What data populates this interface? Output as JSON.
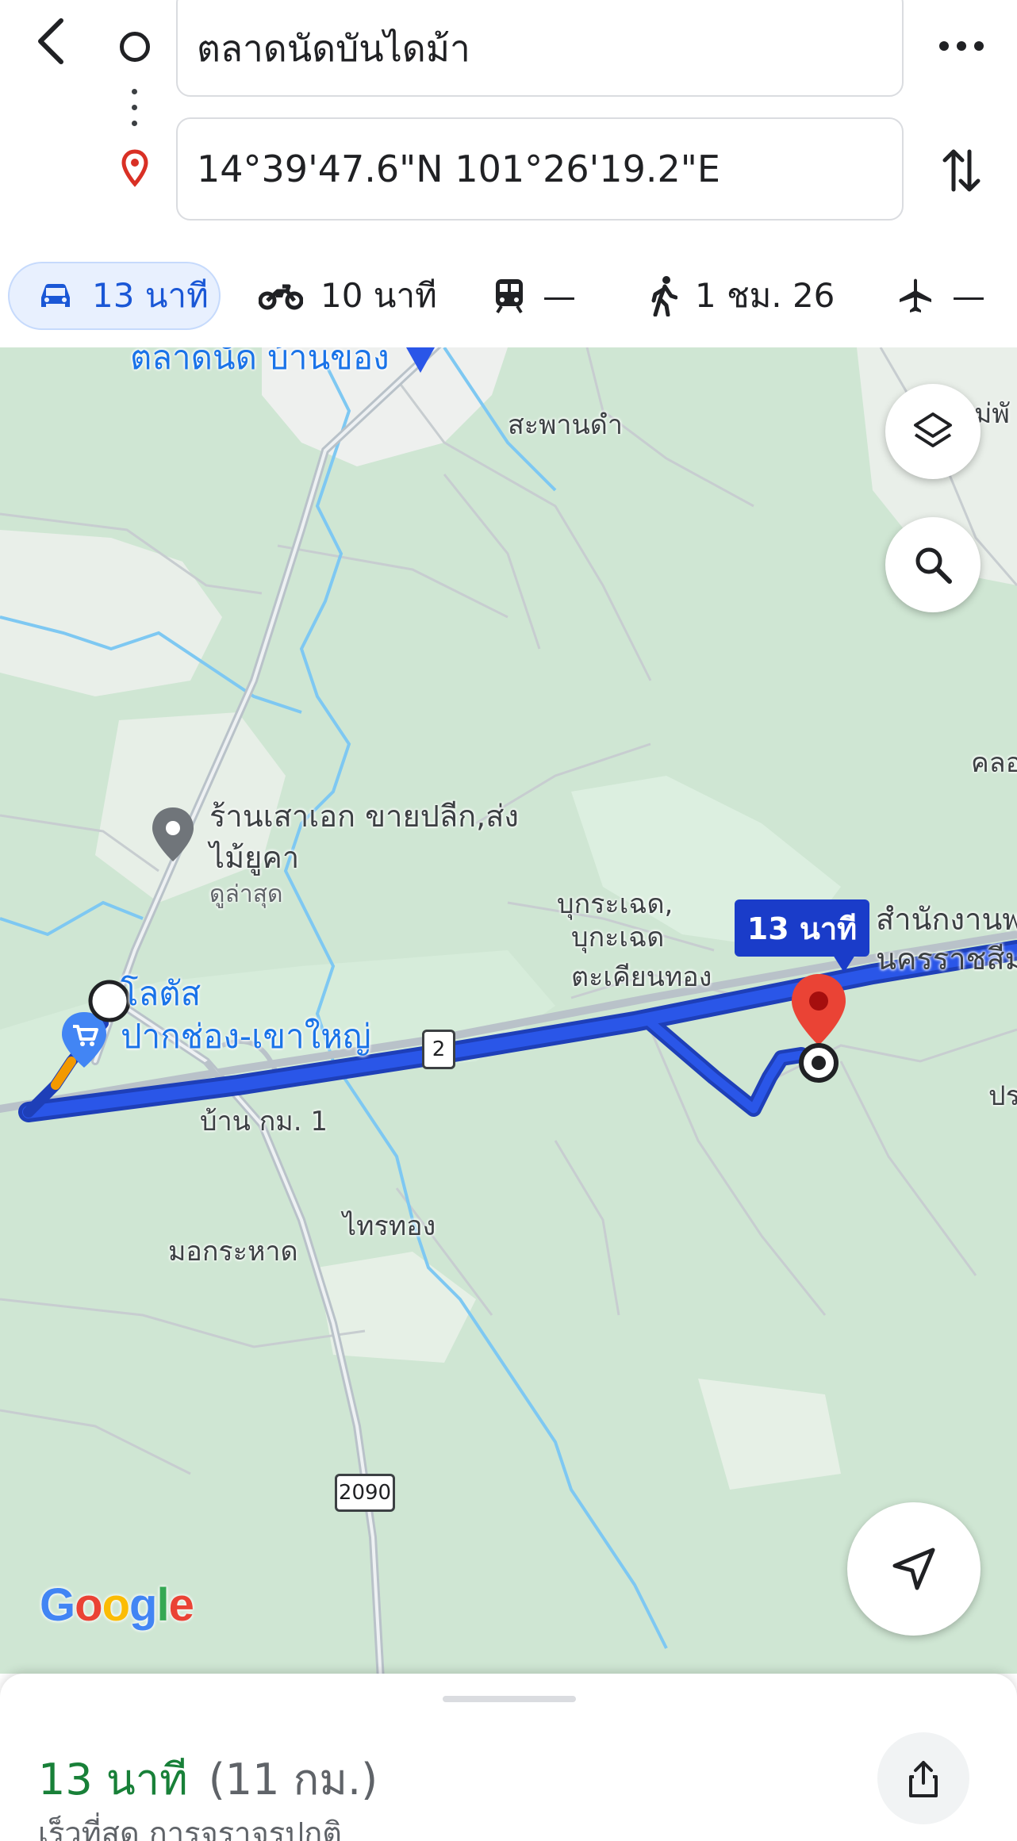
{
  "header": {
    "origin_value": "ตลาดนัดบันไดม้า",
    "destination_value": "14°39'47.6\"N 101°26'19.2\"E",
    "icons": {
      "back": "chevron-left-icon",
      "more": "more-horizontal-icon",
      "swap": "swap-vertical-icon"
    }
  },
  "modes": [
    {
      "id": "car",
      "icon": "car-icon",
      "label": "13 นาที",
      "selected": true
    },
    {
      "id": "motorcycle",
      "icon": "motorcycle-icon",
      "label": "10 นาที",
      "selected": false
    },
    {
      "id": "transit",
      "icon": "train-icon",
      "label": "—",
      "selected": false
    },
    {
      "id": "walk",
      "icon": "walk-icon",
      "label": "1 ชม. 26",
      "selected": false
    },
    {
      "id": "flight",
      "icon": "airplane-icon",
      "label": "—",
      "selected": false
    }
  ],
  "map": {
    "labels": {
      "top_partial": "ตลาดนัด บ้านของ",
      "saphan_dam": "สะพานดำ",
      "mae_phai": "ม่พั",
      "khlong": "คลอ",
      "shop_line1": "ร้านเสาเอก ขายปลีก,ส่ง",
      "shop_line2": "ไม้ยูคา",
      "shop_sub": "ดูล่าสุด",
      "bukraset": "บุกระเฉด,",
      "bukraset2": "บุกะเฉด",
      "takhian_thong": "ตะเคียนทอง",
      "office_line1": "สำนักงานพ",
      "office_line2": "นครราชสีม",
      "lotus_line1": "โลตัส",
      "lotus_line2": "ปากช่อง-เขาใหญ่",
      "ban_km1": "บ้าน กม. 1",
      "pra": "ปร",
      "sai_thong": "ไทรทอง",
      "mok_rahat": "มอกระหาด"
    },
    "route_callout": "13 นาที",
    "shields": {
      "hwy2": "2",
      "hwy2090": "2090"
    },
    "google_logo": "Google",
    "colors": {
      "route": "#2a56e8",
      "callout": "#1a3cc9",
      "pin": "#ea4335",
      "land": "#cfe6d3",
      "water": "#7ec8f2"
    }
  },
  "sheet": {
    "duration": "13 นาที",
    "distance": "(11 กม.)",
    "subtitle": "เร็วที่สุด การจราจรปกติ"
  }
}
